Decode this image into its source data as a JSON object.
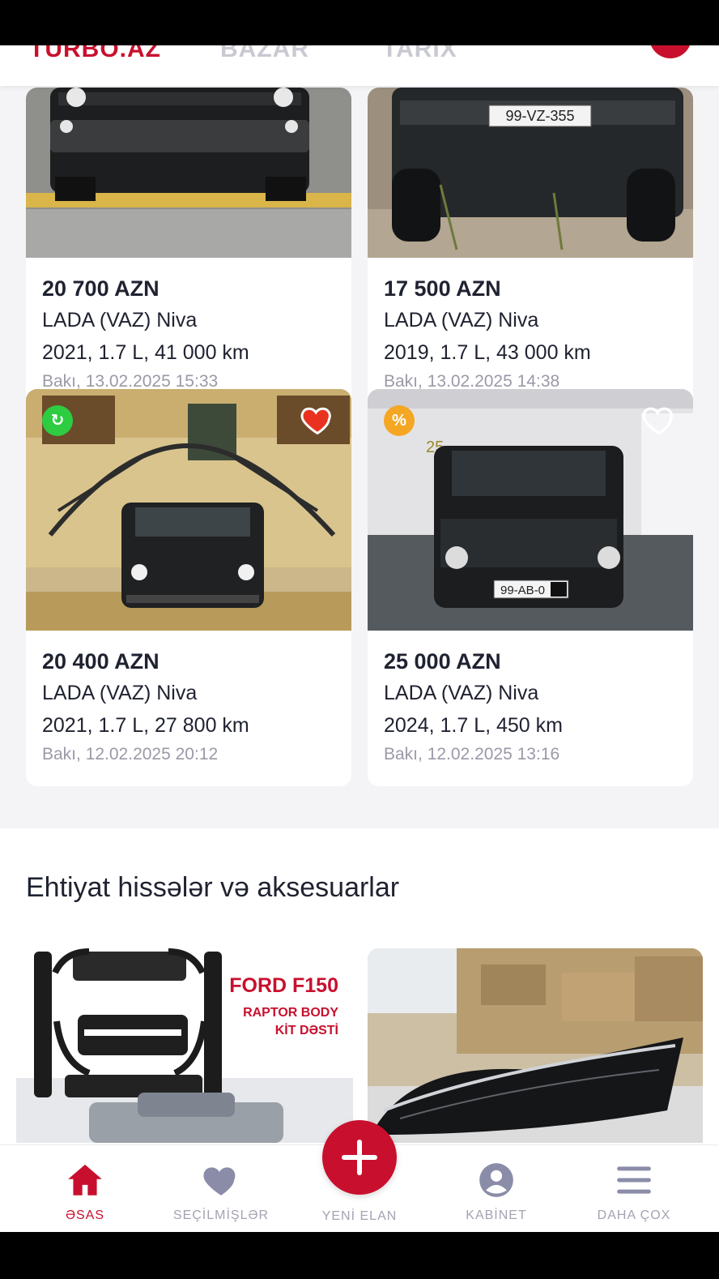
{
  "header": {
    "logo_text": "TURBO.AZ",
    "tab_1": "BAZAR",
    "tab_2": "TARIX"
  },
  "listings": [
    {
      "price": "20 700 AZN",
      "model": "LADA (VAZ) Niva",
      "specs": "2021, 1.7 L, 41 000 km",
      "meta": "Bakı, 13.02.2025 15:33"
    },
    {
      "price": "17 500 AZN",
      "model": "LADA (VAZ) Niva",
      "specs": "2019, 1.7 L, 43 000 km",
      "meta": "Bakı, 13.02.2025 14:38",
      "plate": "99-VZ-355"
    },
    {
      "price": "20 400 AZN",
      "model": "LADA (VAZ) Niva",
      "specs": "2021, 1.7 L, 27 800 km",
      "meta": "Bakı, 12.02.2025 20:12",
      "badge": "barter-icon",
      "favorited": true
    },
    {
      "price": "25 000 AZN",
      "model": "LADA (VAZ) Niva",
      "specs": "2024, 1.7 L, 450 km",
      "meta": "Bakı, 12.02.2025 13:16",
      "badge_text": "%",
      "favorited": false,
      "plate": "99-AB-0",
      "wall_number": "25"
    }
  ],
  "parts_section": {
    "title": "Ehtiyat hissələr və aksesuarlar",
    "items": [
      {
        "heading": "FORD F150",
        "sub_1": "RAPTOR BODY",
        "sub_2": "KİT DƏSTİ"
      },
      {
        "heading": ""
      }
    ]
  },
  "nav": {
    "home": "ƏSAS",
    "favorites": "SEÇİLMİŞLƏR",
    "new_listing": "YENİ ELAN",
    "cabinet": "KABİNET",
    "more": "DAHA ÇOX"
  },
  "colors": {
    "brand": "#c8102e",
    "badge_green": "#2ecc40",
    "badge_orange": "#f5a623"
  }
}
